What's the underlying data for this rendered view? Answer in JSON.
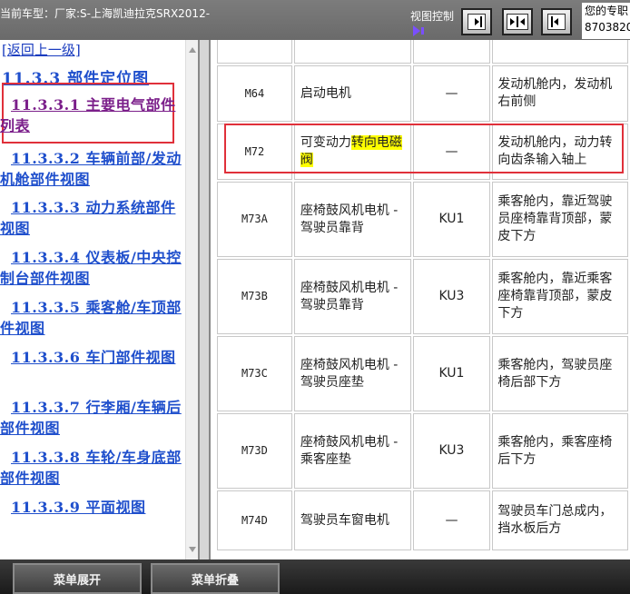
{
  "topbar": {
    "vehicle": "当前车型：厂家:S-上海凯迪拉克SRX2012-",
    "view_control": "视图控制",
    "contact_line1": "您的专职",
    "contact_line2": "8703820"
  },
  "nav": {
    "back": "[返回上一级]",
    "title": "11.3.3 部件定位图",
    "items": [
      {
        "label": "11.3.3.1 主要电气部件列表"
      },
      {
        "label": "11.3.3.2 车辆前部/发动机舱部件视图"
      },
      {
        "label": "11.3.3.3 动力系统部件视图"
      },
      {
        "label": "11.3.3.4 仪表板/中央控制台部件视图"
      },
      {
        "label": "11.3.3.5 乘客舱/车顶部件视图"
      },
      {
        "label": "11.3.3.6 车门部件视图"
      },
      {
        "label": "11.3.3.7 行李厢/车辆后部件视图"
      },
      {
        "label": "11.3.3.8 车轮/车身底部部件视图"
      },
      {
        "label": "11.3.3.9 平面视图"
      }
    ]
  },
  "table": {
    "rows": [
      {
        "code": "",
        "name": "",
        "conn": "",
        "loc": ""
      },
      {
        "code": "M64",
        "name": "启动电机",
        "conn": "—",
        "loc": "发动机舱内，发动机右前侧"
      },
      {
        "code": "M72",
        "name_a": "可变动力",
        "name_b": "转向电磁阀",
        "conn": "—",
        "loc": "发动机舱内，动力转向齿条输入轴上"
      },
      {
        "code": "M73A",
        "name": "座椅鼓风机电机 - 驾驶员靠背",
        "conn": "KU1",
        "loc": "乘客舱内，靠近驾驶员座椅靠背顶部，蒙皮下方"
      },
      {
        "code": "M73B",
        "name": "座椅鼓风机电机 - 驾驶员靠背",
        "conn": "KU3",
        "loc": "乘客舱内，靠近乘客座椅靠背顶部，蒙皮下方"
      },
      {
        "code": "M73C",
        "name": "座椅鼓风机电机 - 驾驶员座垫",
        "conn": "KU1",
        "loc": "乘客舱内，驾驶员座椅后部下方"
      },
      {
        "code": "M73D",
        "name": "座椅鼓风机电机 - 乘客座垫",
        "conn": "KU3",
        "loc": "乘客舱内，乘客座椅后下方"
      },
      {
        "code": "M74D",
        "name": "驾驶员车窗电机",
        "conn": "—",
        "loc": "驾驶员车门总成内，挡水板后方"
      }
    ]
  },
  "bottom": {
    "expand": "菜单展开",
    "collapse": "菜单折叠"
  },
  "colors": {
    "highlight_box": "#e0303a",
    "link": "#1f4fcc",
    "visited_link": "#7b1f8a",
    "text_highlight": "#ffff00"
  },
  "icons": [
    "view-left-icon",
    "view-center-icon",
    "view-right-icon",
    "view-indicator-icon"
  ]
}
